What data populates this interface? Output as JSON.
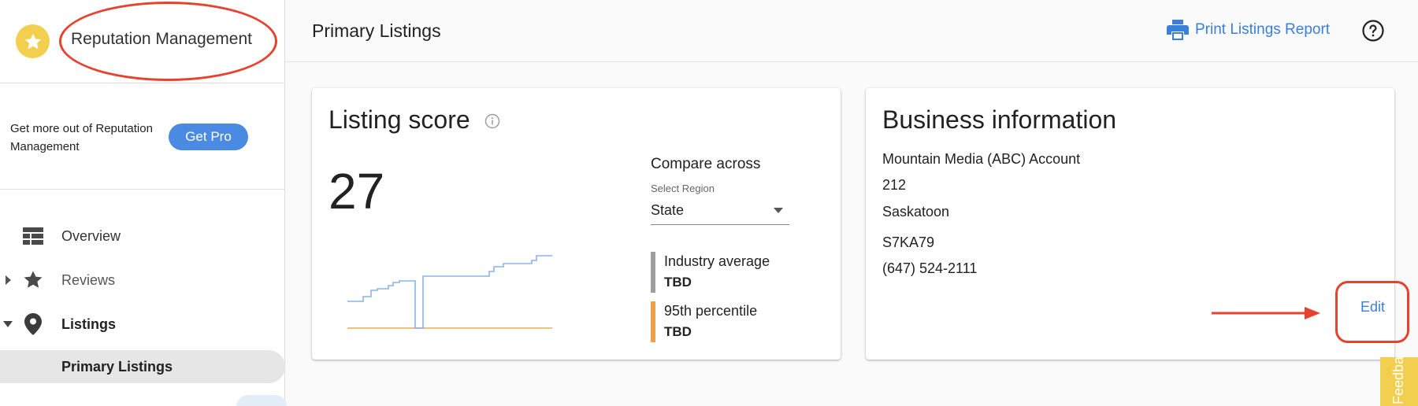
{
  "app": {
    "title": "Reputation Management",
    "logo_icon": "star-icon",
    "brand_color": "#f3cf4f"
  },
  "promo": {
    "text": "Get more out of Reputation Management",
    "button_label": "Get Pro"
  },
  "nav": {
    "items": [
      {
        "label": "Overview",
        "icon": "overview-icon"
      },
      {
        "label": "Reviews",
        "icon": "star-icon"
      },
      {
        "label": "Listings",
        "icon": "location-pin-icon"
      }
    ],
    "sub_items": [
      {
        "label": "Primary Listings"
      }
    ]
  },
  "header": {
    "title": "Primary Listings",
    "print_label": "Print Listings Report",
    "accent_color": "#3a7fdb"
  },
  "listing_card": {
    "title": "Listing score",
    "score": "27",
    "compare_label": "Compare across",
    "select_label": "Select Region",
    "select_value": "State",
    "legend": [
      {
        "name": "Industry average",
        "value": "TBD",
        "color": "#9e9e9e"
      },
      {
        "name": "95th percentile",
        "value": "TBD",
        "color": "#f0a04b"
      }
    ]
  },
  "business_card": {
    "title": "Business information",
    "lines": [
      "Mountain Media (ABC) Account",
      "212",
      "Saskatoon",
      "S7KA79",
      "(647) 524-2111"
    ],
    "edit_label": "Edit"
  },
  "feedback": {
    "label": "Feedback"
  },
  "annotation_color": "#e5432f"
}
